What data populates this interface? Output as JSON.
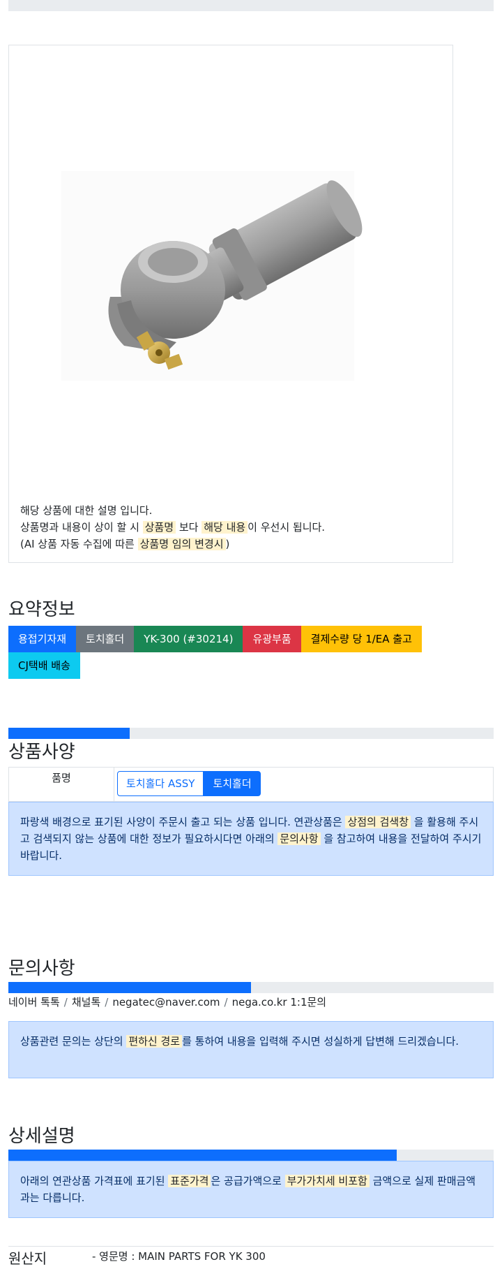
{
  "product": {
    "description": {
      "line1": "해당 상품에 대한 설명 입니다.",
      "line2": {
        "pre": "상품명과 내용이 상이 할 시 ",
        "hl1": "상품명",
        "mid": " 보다 ",
        "hl2": "해당 내용",
        "post": "이 우선시 됩니다."
      },
      "line3": {
        "pre": "(AI 상품 자동 수집에 따른 ",
        "hl": "상품명 임의 변경시",
        "post": ")"
      }
    },
    "image_icon": "torch-holder-photo"
  },
  "summary": {
    "title": "요약정보",
    "badges": [
      "용접기자재",
      "토치홀더",
      "YK-300 (#30214)",
      "유광부품",
      "결제수량 당 1/EA 출고",
      "CJ택배 배송"
    ]
  },
  "spec": {
    "title": "상품사양",
    "progress_percent": 25,
    "row_header": "품명",
    "options": [
      "토치홀다 ASSY",
      "토치홀더"
    ],
    "selected_option": "토치홀더",
    "notice": {
      "pre": "파랑색 배경으로 표기된 사양이 주문시 출고 되는 상품 입니다. 연관상품은 ",
      "hl1": "상점의 검색창",
      "mid": " 을 활용해 주시고 검색되지 않는 상품에 대한 정보가 필요하시다면 아래의 ",
      "hl2": "문의사항",
      "post": " 을 참고하여 내용을 전달하여 주시기 바랍니다."
    }
  },
  "inquiry": {
    "title": "문의사항",
    "progress_percent": 50,
    "contacts": [
      "네이버 톡톡",
      "채널톡",
      "negatec@naver.com",
      "nega.co.kr 1:1문의"
    ],
    "separator": "/",
    "notice": {
      "pre": "상품관련 문의는 상단의 ",
      "hl": "편하신 경로",
      "post": "를 통하여 내용을 입력해 주시면 성실하게 답변해 드리겠습니다."
    }
  },
  "detail": {
    "title": "상세설명",
    "progress_percent": 80,
    "notice": {
      "pre": "아래의 연관상품 가격표에 표기된 ",
      "hl1": "표준가격",
      "mid": "은 공급가액으로 ",
      "hl2": "부가가치세 비포함",
      "post": " 금액으로 실제 판매금액과는 다릅니다."
    }
  },
  "origin": {
    "label": "원산지",
    "value": "- 영문명 : MAIN PARTS FOR YK 300"
  },
  "colors": {
    "primary": "#0d6efd",
    "highlight": "#fff3cd",
    "alert_bg": "#cfe2ff"
  }
}
